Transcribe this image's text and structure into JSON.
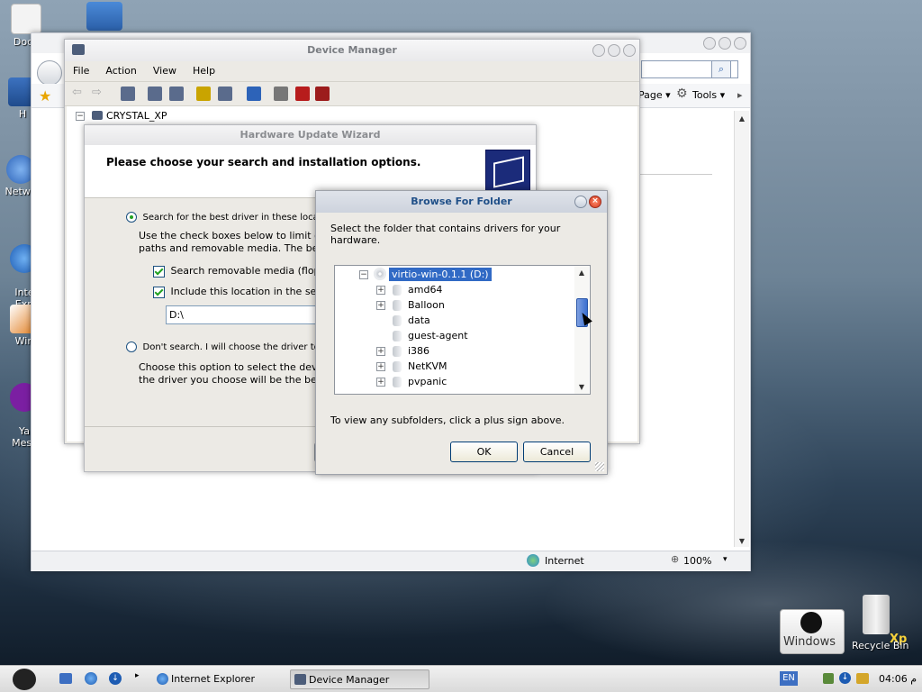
{
  "desktop": {
    "icons": [
      {
        "label": "Docu",
        "name": "my-documents-icon"
      },
      {
        "label": "H",
        "name": "my-computer-icon"
      },
      {
        "label": "Netwo",
        "name": "network-icon"
      },
      {
        "label": "Inte\nExp",
        "name": "internet-explorer-icon"
      },
      {
        "label": "Win",
        "name": "shortcut-icon"
      },
      {
        "label": "Ya\nMess",
        "name": "yahoo-messenger-icon"
      }
    ],
    "windows_badge": "Windows",
    "recycle_bin": "Recycle Bin",
    "xp_badge": "Xp"
  },
  "ie_window": {
    "toolbar_page": "Page",
    "toolbar_tools": "Tools",
    "status_zone": "Internet",
    "zoom": "100%"
  },
  "device_manager": {
    "title": "Device Manager",
    "menu": [
      "File",
      "Action",
      "View",
      "Help"
    ],
    "tree_root": "CRYSTAL_XP"
  },
  "wizard": {
    "title": "Hardware Update Wizard",
    "heading": "Please choose your search and installation options.",
    "option_search": "Search for the best driver in these locations.",
    "search_desc_1": "Use the check boxes below to limit or exp",
    "search_desc_2": "paths and removable media. The best driv",
    "check_removable": "Search removable media (floppy, C",
    "check_include": "Include this location in the search:",
    "location_value": "D:\\",
    "option_dont": "Don't search. I will choose the driver to install.",
    "dont_desc_1": "Choose this option to select the device dr",
    "dont_desc_2": "the driver you choose will be the best mat"
  },
  "browse": {
    "title": "Browse For Folder",
    "instruction": "Select the folder that contains drivers for your hardware.",
    "tree": [
      {
        "label": "virtio-win-0.1.1 (D:)",
        "expander": "−",
        "selected": true
      },
      {
        "label": "amd64",
        "expander": "+"
      },
      {
        "label": "Balloon",
        "expander": "+"
      },
      {
        "label": "data",
        "expander": ""
      },
      {
        "label": "guest-agent",
        "expander": ""
      },
      {
        "label": "i386",
        "expander": "+"
      },
      {
        "label": "NetKVM",
        "expander": "+"
      },
      {
        "label": "pvpanic",
        "expander": "+"
      }
    ],
    "hint": "To view any subfolders, click a plus sign above.",
    "ok": "OK",
    "cancel": "Cancel"
  },
  "taskbar": {
    "items": [
      {
        "label": "Internet Explorer can...",
        "active": false
      },
      {
        "label": "Device Manager",
        "active": true
      }
    ],
    "language": "EN",
    "clock": "04:06 م"
  }
}
